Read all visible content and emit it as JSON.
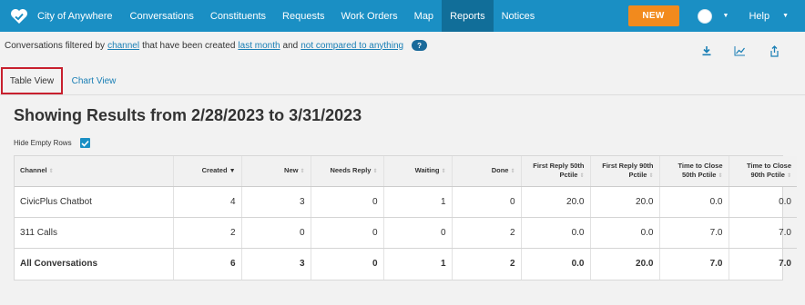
{
  "nav": {
    "brand": "City of Anywhere",
    "items": [
      {
        "label": "Conversations",
        "active": false
      },
      {
        "label": "Constituents",
        "active": false
      },
      {
        "label": "Requests",
        "active": false
      },
      {
        "label": "Work Orders",
        "active": false
      },
      {
        "label": "Map",
        "active": false
      },
      {
        "label": "Reports",
        "active": true
      },
      {
        "label": "Notices",
        "active": false
      }
    ],
    "new_label": "NEW",
    "help_label": "Help"
  },
  "filter": {
    "prefix": "Conversations filtered by",
    "link1": "channel",
    "mid1": "that have been created",
    "link2": "last month",
    "mid2": "and",
    "link3": "not compared to anything",
    "help_badge": "?"
  },
  "tabs": {
    "table": "Table View",
    "chart": "Chart View"
  },
  "results_title": "Showing Results from 2/28/2023 to 3/31/2023",
  "hide_empty_label": "Hide Empty Rows",
  "hide_empty_checked": true,
  "table": {
    "columns": [
      {
        "label": "Channel",
        "sort": "none"
      },
      {
        "label": "Created",
        "sort": "desc"
      },
      {
        "label": "New",
        "sort": "none"
      },
      {
        "label": "Needs Reply",
        "sort": "none"
      },
      {
        "label": "Waiting",
        "sort": "none"
      },
      {
        "label": "Done",
        "sort": "none"
      },
      {
        "label": "First Reply 50th Pctile",
        "sort": "none"
      },
      {
        "label": "First Reply 90th Pctile",
        "sort": "none"
      },
      {
        "label": "Time to Close 50th Pctile",
        "sort": "none"
      },
      {
        "label": "Time to Close 90th Pctile",
        "sort": "none"
      }
    ],
    "rows": [
      [
        "CivicPlus Chatbot",
        "4",
        "3",
        "0",
        "1",
        "0",
        "20.0",
        "20.0",
        "0.0",
        "0.0"
      ],
      [
        "311 Calls",
        "2",
        "0",
        "0",
        "0",
        "2",
        "0.0",
        "0.0",
        "7.0",
        "7.0"
      ]
    ],
    "total": [
      "All Conversations",
      "6",
      "3",
      "0",
      "1",
      "2",
      "0.0",
      "20.0",
      "7.0",
      "7.0"
    ]
  },
  "colors": {
    "nav_bg": "#1a8fc4",
    "nav_active": "#116e99",
    "new_button": "#f28a1d",
    "link": "#1a7fb5",
    "selected_tab_outline": "#c8202e"
  }
}
